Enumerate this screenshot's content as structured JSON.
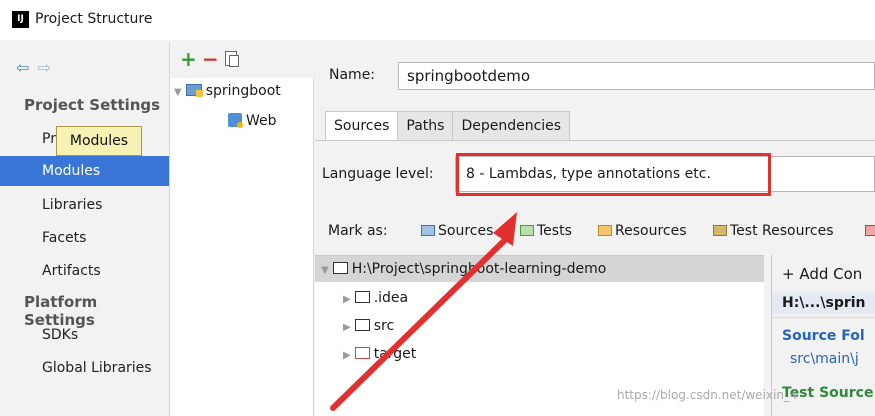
{
  "window": {
    "logo_text": "IJ",
    "title": "Project Structure"
  },
  "left_nav": {
    "sections": {
      "project_settings": "Project Settings",
      "platform_settings": "Platform Settings"
    },
    "items": {
      "project": "Pr",
      "modules": "Modules",
      "libraries": "Libraries",
      "facets": "Facets",
      "artifacts": "Artifacts",
      "sdks": "SDKs",
      "global_libraries": "Global Libraries"
    },
    "tooltip": "Modules"
  },
  "module_tree": {
    "add": "+",
    "remove": "−",
    "nodes": [
      {
        "label": "springboot"
      },
      {
        "label": "Web"
      }
    ]
  },
  "details": {
    "name_label": "Name:",
    "name_value": "springbootdemo",
    "tabs": [
      "Sources",
      "Paths",
      "Dependencies"
    ],
    "active_tab": "Sources",
    "language_label": "Language level:",
    "language_value": "8 - Lambdas, type annotations etc.",
    "mark_as_label": "Mark as:",
    "mark_as": [
      "Sources",
      "Tests",
      "Resources",
      "Test Resources"
    ],
    "content_root": "H:\\Project\\springboot-learning-demo",
    "folders": [
      ".idea",
      "src",
      "target"
    ],
    "roots_panel": {
      "add_label": "+ Add Con",
      "path": "H:\\...\\sprin",
      "source_heading": "Source Fol",
      "source_value": "src\\main\\j",
      "test_heading": "Test Source"
    }
  },
  "watermark": "https://blog.csdn.net/weixin_4",
  "colors": {
    "selection": "#3875d7",
    "highlight_box": "#e03030",
    "tooltip_bg": "#f7f1b4"
  }
}
